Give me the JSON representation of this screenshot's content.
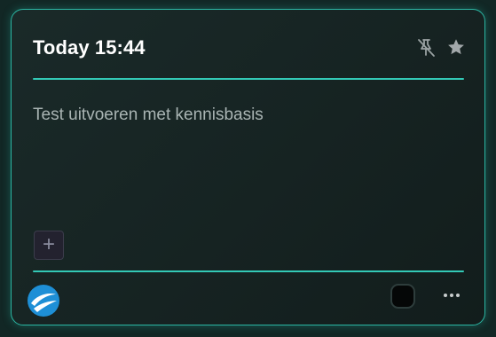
{
  "note": {
    "title": "Today 15:44",
    "content": "Test uitvoeren met kennisbasis"
  },
  "header": {
    "pin_icon": "pin-off-icon",
    "star_icon": "star-icon"
  },
  "toolbar": {
    "add_label": "+",
    "logo_icon": "app-logo-icon",
    "color_swatch": "#050707",
    "more_icon": "more-horizontal-icon"
  },
  "colors": {
    "accent": "#33c9b6",
    "background": "#162322",
    "title": "#ffffff",
    "text": "#a9b4b3"
  }
}
